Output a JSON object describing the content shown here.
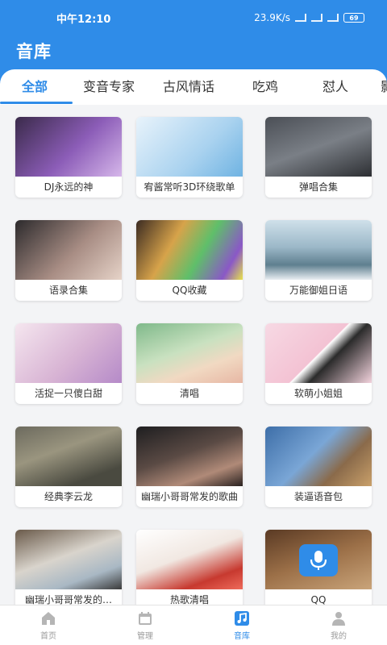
{
  "status": {
    "time": "中午12:10",
    "net_speed": "23.9K/s",
    "battery": "69"
  },
  "app": {
    "title": "音库"
  },
  "tabs": [
    {
      "label": "全部"
    },
    {
      "label": "变音专家"
    },
    {
      "label": "古风情话"
    },
    {
      "label": "吃鸡"
    },
    {
      "label": "怼人"
    },
    {
      "label": "影"
    }
  ],
  "albums": [
    {
      "label": "DJ永远的神",
      "thumb": "photo-girl-purple-icon"
    },
    {
      "label": "宥酱常听3D环绕歌单",
      "thumb": "anime-girl-cat-icon"
    },
    {
      "label": "弹唱合集",
      "thumb": "photo-person-dark-icon"
    },
    {
      "label": "语录合集",
      "thumb": "photo-girl-black-icon"
    },
    {
      "label": "QQ收藏",
      "thumb": "photo-colorful-abstract-icon"
    },
    {
      "label": "万能御姐日语",
      "thumb": "photo-girl-sea-icon"
    },
    {
      "label": "活捉一只傻白甜",
      "thumb": "anime-girl-pink-icon"
    },
    {
      "label": "清唱",
      "thumb": "anime-girl-green-icon"
    },
    {
      "label": "软萌小姐姐",
      "thumb": "drawing-girl-hat-icon"
    },
    {
      "label": "经典李云龙",
      "thumb": "photo-soldier-icon"
    },
    {
      "label": "幽瑞小哥哥常发的歌曲",
      "thumb": "photo-girl-closeup-icon"
    },
    {
      "label": "装逼语音包",
      "thumb": "cartoon-cat-icon"
    },
    {
      "label": "幽瑞小哥哥常发的…",
      "thumb": "photo-car-icon"
    },
    {
      "label": "热歌清唱",
      "thumb": "photo-girl-headphones-icon"
    },
    {
      "label": "QQ",
      "thumb": "microphone-icon"
    }
  ],
  "nav": [
    {
      "label": "首页",
      "icon": "home-icon"
    },
    {
      "label": "管理",
      "icon": "calendar-icon"
    },
    {
      "label": "音库",
      "icon": "music-library-icon"
    },
    {
      "label": "我的",
      "icon": "person-icon"
    }
  ],
  "colors": {
    "accent": "#2f8ce8",
    "background": "#f3f4f6",
    "inactive": "#9b9b9b"
  }
}
